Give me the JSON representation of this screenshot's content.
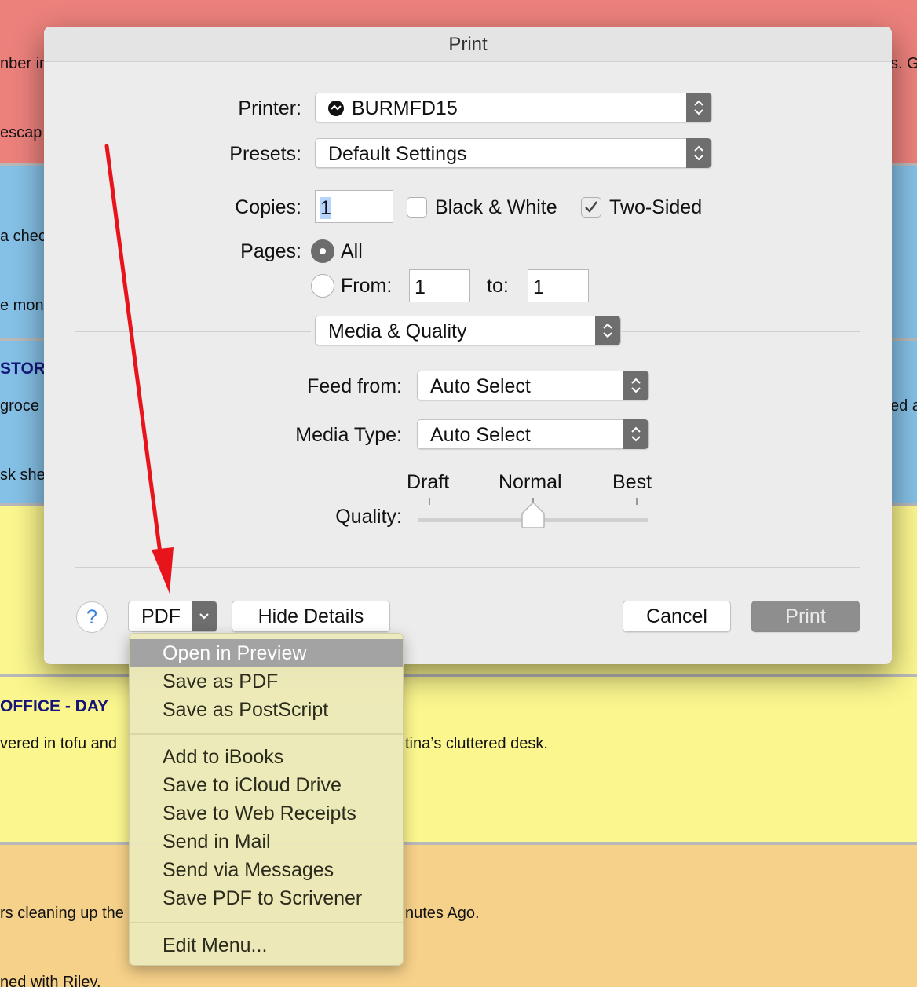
{
  "dialog": {
    "title": "Print",
    "printer_label": "Printer:",
    "printer_value": "BURMFD15",
    "presets_label": "Presets:",
    "presets_value": "Default Settings",
    "copies_label": "Copies:",
    "copies_value": "1",
    "bw_label": "Black & White",
    "bw_checked": false,
    "twosided_label": "Two-Sided",
    "twosided_checked": true,
    "pages_label": "Pages:",
    "pages_all_label": "All",
    "pages_from_label": "From:",
    "pages_from_value": "1",
    "pages_to_label": "to:",
    "pages_to_value": "1",
    "section_value": "Media & Quality",
    "feed_label": "Feed from:",
    "feed_value": "Auto Select",
    "media_label": "Media Type:",
    "media_value": "Auto Select",
    "quality_label": "Quality:",
    "quality_draft": "Draft",
    "quality_normal": "Normal",
    "quality_best": "Best",
    "quality_level": "Normal",
    "help_label": "?",
    "pdf_label": "PDF",
    "hide_details_label": "Hide Details",
    "cancel_label": "Cancel",
    "print_label": "Print"
  },
  "pdf_menu": {
    "items_group1": [
      "Open in Preview",
      "Save as PDF",
      "Save as PostScript"
    ],
    "items_group2": [
      "Add to iBooks",
      "Save to iCloud Drive",
      "Save to Web Receipts",
      "Send in Mail",
      "Send via Messages",
      "Save PDF to Scrivener"
    ],
    "items_group3": [
      "Edit Menu..."
    ],
    "highlighted": "Open in Preview"
  },
  "background": {
    "band1_left1": "nber in",
    "band1_right": "s. G",
    "band1_left2": "escap",
    "band2_left1": "a chec",
    "band2_left2": "e mon",
    "band3_heading": "STOR",
    "band3_left1": "groce",
    "band3_right": "ed a",
    "band3_left2": "sk she",
    "band5_heading": "OFFICE - DAY",
    "band5_left": "vered in tofu and",
    "band5_right": "tina’s cluttered desk.",
    "band6_left1": "rs cleaning up the",
    "band6_right": "nutes Ago.",
    "band6_left2": "ned with Riley."
  },
  "colors": {
    "band_red": "#ec817c",
    "band_blue": "#85c0e6",
    "band_yellow": "#fbf68e",
    "band_orange": "#f6d189",
    "annotation_arrow": "#e8141c",
    "menu_bg": "#ece9ba"
  }
}
